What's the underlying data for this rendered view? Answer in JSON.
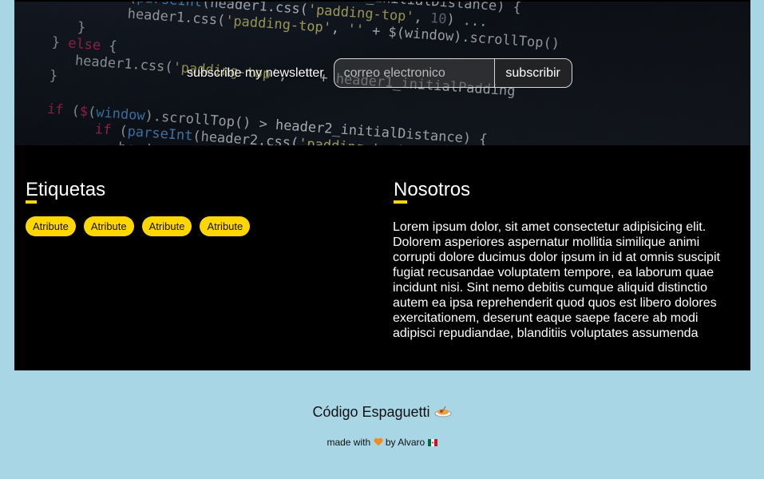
{
  "newsletter": {
    "label": "subscribe my newsletter",
    "placeholder": "correo electronico",
    "button": "subscribir"
  },
  "tags_section": {
    "title": "Etiquetas",
    "tags": [
      "Atribute",
      "Atribute",
      "Atribute",
      "Atribute"
    ]
  },
  "about": {
    "title": "Nosotros",
    "text": "Lorem ipsum dolor, sit amet consectetur adipisicing elit. Dolorem asperiores aspernatur mollitia similique animi corrupti dolore ducimus dolor ipsum in id at omnis suscipit fugiat recusandae voluptatem tempore, ea laborum quae incidunt nisi. Sint nemo debitis cumque aliquid distinctio autem ea ipsa reprehenderit quod quos est libero dolores exercitationem, deserunt eaque saepe facere ab modi adipisci repudiandae, blanditiis voluptates assumenda"
  },
  "footer": {
    "title": "Código Espaguetti",
    "made_with": "made with",
    "by": "by Alvaro",
    "icons": [
      "spaghetti-icon",
      "heart-icon",
      "mexico-flag-icon"
    ]
  },
  "colors": {
    "accent": "#ffd700",
    "page_background": "#a9d6e5",
    "content_background": "#000000"
  }
}
